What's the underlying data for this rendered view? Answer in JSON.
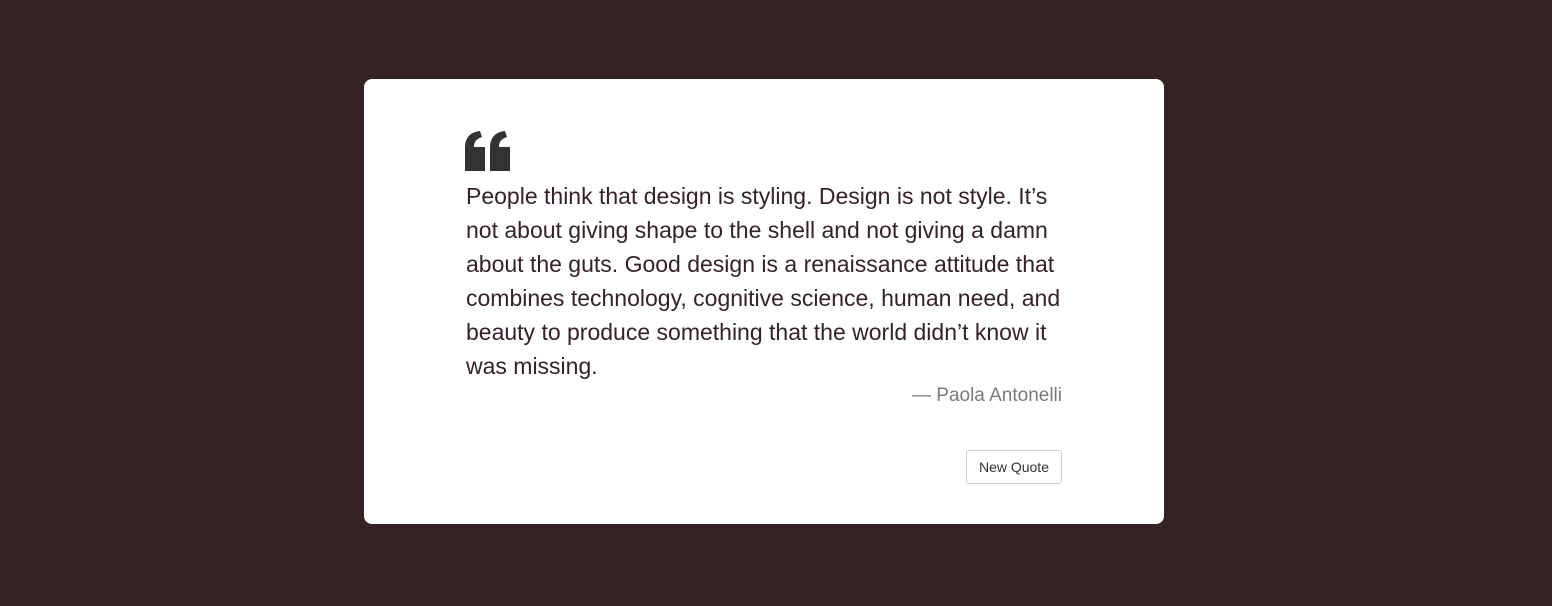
{
  "quote": {
    "text": "People think that design is styling. Design is not style. It’s not about giving shape to the shell and not giving a damn about the guts. Good design is a renaissance attitude that combines technology, cognitive science, human need, and beauty to produce something that the world didn’t know it was missing.",
    "author": "— Paola Antonelli",
    "icon": "quote-left-icon"
  },
  "actions": {
    "new_quote_label": "New Quote"
  },
  "colors": {
    "background": "#352224",
    "card": "#ffffff",
    "quote_text": "#352224",
    "author_text": "#7a7a7a",
    "icon": "#333333"
  }
}
